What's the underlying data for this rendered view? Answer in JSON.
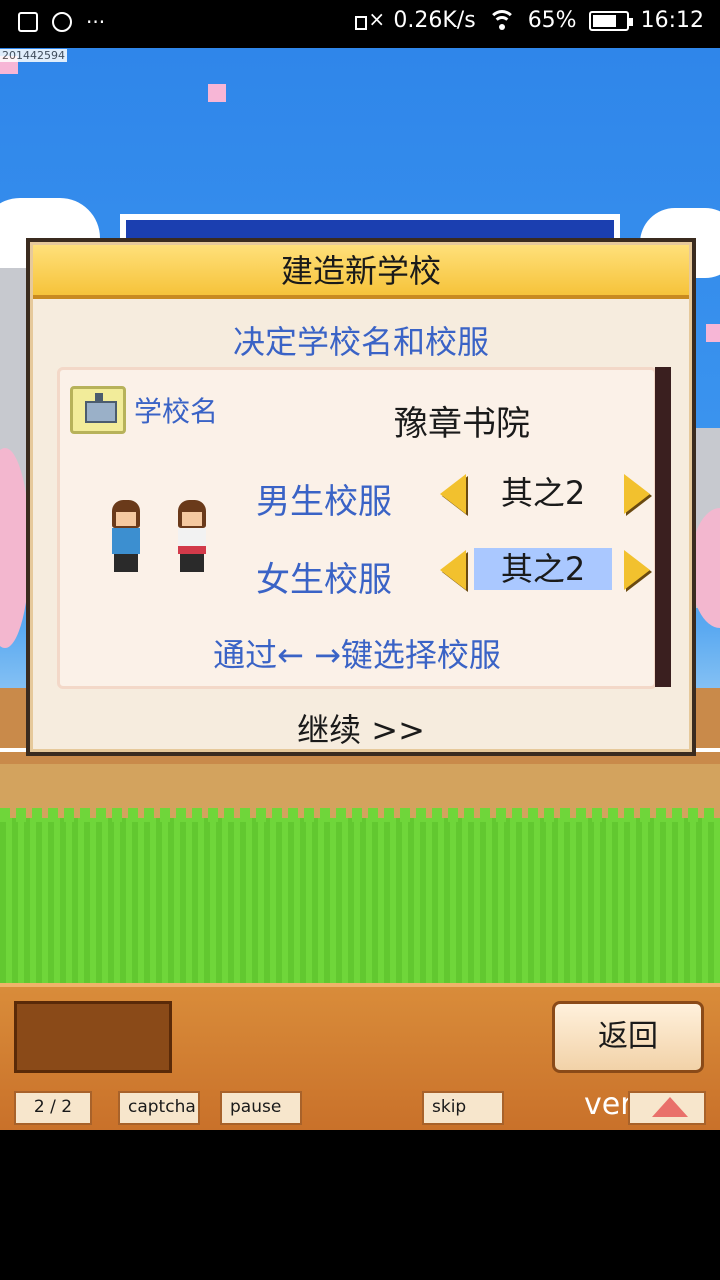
{
  "status_bar": {
    "network_speed": "0.26K/s",
    "battery": "65%",
    "time": "16:12",
    "icons": [
      "image-icon",
      "chat-icon",
      "more-icon",
      "mute-icon",
      "wifi-icon",
      "battery-icon"
    ]
  },
  "overlay_id": "201442594",
  "dialog": {
    "title": "建造新学校",
    "subtitle": "决定学校名和校服",
    "school_name_label": "学校名",
    "school_name_value": "豫章书院",
    "boy_uniform_label": "男生校服",
    "boy_uniform_value": "其之2",
    "girl_uniform_label": "女生校服",
    "girl_uniform_value": "其之2",
    "hint": "通过← →键选择校服",
    "continue_label": "继续 >>"
  },
  "bottom_bar": {
    "back_label": "返回",
    "page_label": "2 / 2",
    "captcha_label": "captcha",
    "pause_label": "pause",
    "skip_label": "skip",
    "version_label": "ver 4."
  },
  "colors": {
    "accent_blue": "#3a63c6",
    "title_yellow": "#f6c33a",
    "selected_option": "#aac8ff",
    "bar_orange": "#d98c3a"
  }
}
